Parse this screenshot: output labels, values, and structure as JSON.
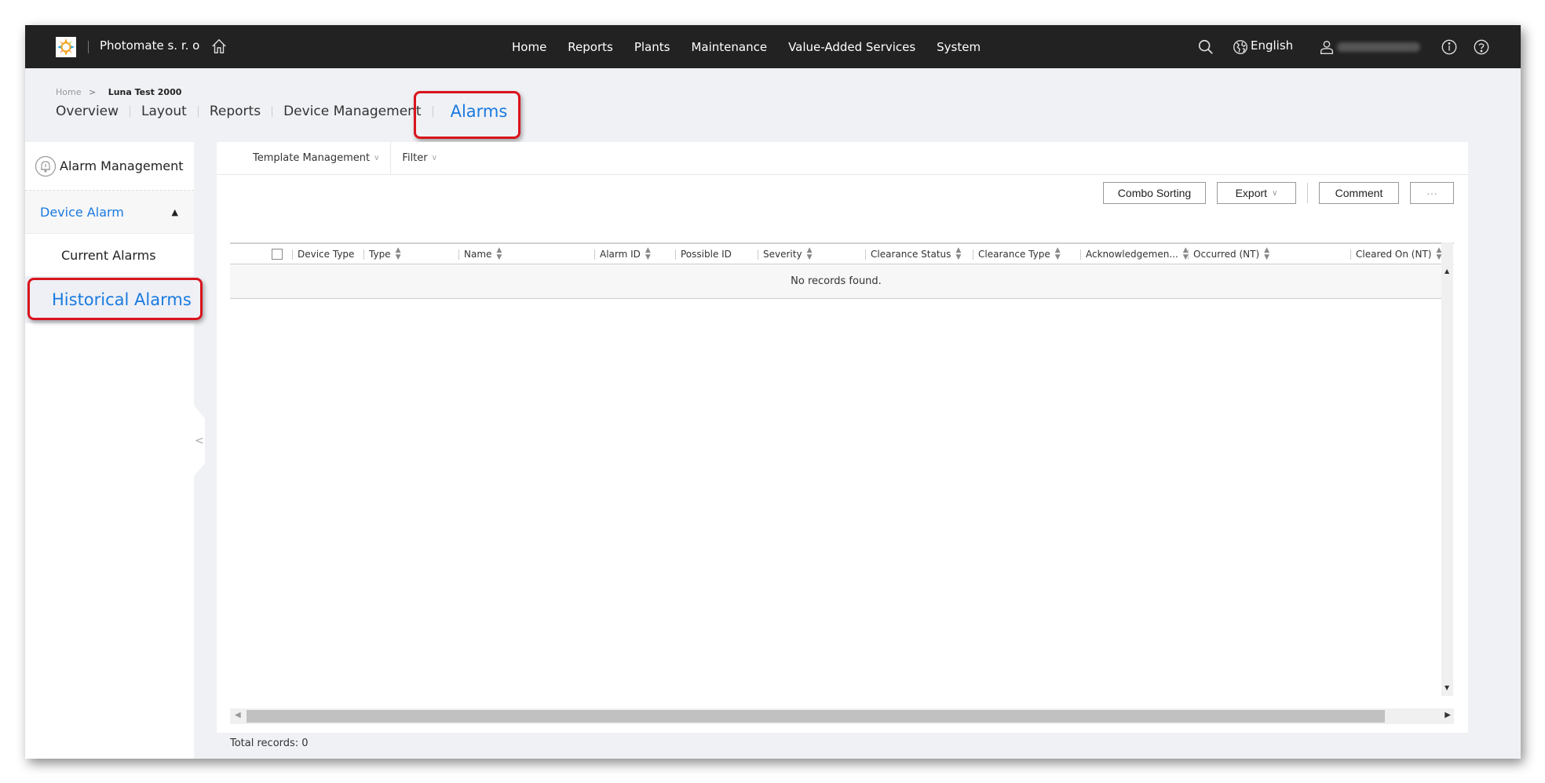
{
  "topbar": {
    "brand": "Photomate s. r. o",
    "nav": [
      "Home",
      "Reports",
      "Plants",
      "Maintenance",
      "Value-Added Services",
      "System"
    ],
    "language": "English",
    "icons": [
      "home-icon",
      "search-icon",
      "globe-icon",
      "user-icon",
      "info-icon",
      "help-icon"
    ]
  },
  "breadcrumb": {
    "home": "Home",
    "separator": ">",
    "current": "Luna Test 2000"
  },
  "tabs": [
    {
      "label": "Overview",
      "active": false
    },
    {
      "label": "Layout",
      "active": false
    },
    {
      "label": "Reports",
      "active": false
    },
    {
      "label": "Device Management",
      "active": false
    },
    {
      "label": "Alarms",
      "active": true
    }
  ],
  "sidebar": {
    "title": "Alarm Management",
    "group": "Device Alarm",
    "group_caret": "^",
    "items": [
      {
        "label": "Current Alarms",
        "active": false
      },
      {
        "label": "Historical Alarms",
        "active": true
      }
    ],
    "collapse_icon": "<"
  },
  "toolbar": {
    "template_management": "Template Management",
    "filter": "Filter",
    "buttons": {
      "combo_sorting": "Combo Sorting",
      "export": "Export",
      "comment": "Comment",
      "more": "···"
    }
  },
  "table": {
    "columns": [
      {
        "label": "Device Type",
        "sortable": false
      },
      {
        "label": "Type",
        "sortable": true
      },
      {
        "label": "Name",
        "sortable": true
      },
      {
        "label": "Alarm ID",
        "sortable": true
      },
      {
        "label": "Possible ID",
        "sortable": false
      },
      {
        "label": "Severity",
        "sortable": true
      },
      {
        "label": "Clearance Status",
        "sortable": true
      },
      {
        "label": "Clearance Type",
        "sortable": true
      },
      {
        "label": "Acknowledgemen...",
        "sortable": true
      },
      {
        "label": "Occurred (NT)",
        "sortable": true
      },
      {
        "label": "Cleared On (NT)",
        "sortable": true
      }
    ],
    "rows": [],
    "empty_message": "No records found."
  },
  "footer": {
    "total_records": "Total records: 0"
  },
  "colors": {
    "accent": "#1a7ae0",
    "topbar": "#222222",
    "highlight": "#d9141c"
  }
}
